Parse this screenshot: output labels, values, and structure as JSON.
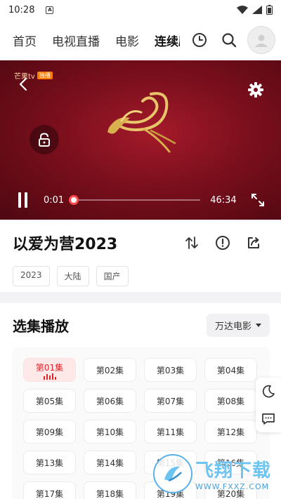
{
  "status_bar": {
    "time": "10:28",
    "sim_label": "A"
  },
  "nav": {
    "tabs": [
      {
        "label": "首页"
      },
      {
        "label": "电视直播"
      },
      {
        "label": "电影"
      },
      {
        "label": "连续剧"
      }
    ],
    "active_tab": "连续剧"
  },
  "player": {
    "logo_text": "芒果tv",
    "logo_tag": "独播",
    "current_time": "0:01",
    "total_time": "46:34",
    "progress": 0.0
  },
  "show": {
    "title": "以爱为营2023",
    "tags": [
      "2023",
      "大陆",
      "国产"
    ]
  },
  "episodes": {
    "section_title": "选集播放",
    "source": "万达电影",
    "items": [
      "第01集",
      "第02集",
      "第03集",
      "第04集",
      "第05集",
      "第06集",
      "第07集",
      "第08集",
      "第09集",
      "第10集",
      "第11集",
      "第12集",
      "第13集",
      "第14集",
      "第15集",
      "第16集",
      "第17集",
      "第18集",
      "第19集",
      "第20集"
    ],
    "active_index": 0
  },
  "watermark": {
    "cn": "飞翔下载",
    "url": "WWW.FXXZ.COM"
  },
  "colors": {
    "accent": "#e0242b",
    "player_bg": "#7a0f1c",
    "progress": "#ff5f00"
  },
  "icons": [
    "history-icon",
    "search-icon",
    "avatar-icon",
    "back-icon",
    "settings-icon",
    "lock-icon",
    "pause-icon",
    "fullscreen-icon",
    "sort-icon",
    "report-icon",
    "share-icon",
    "night-mode-icon",
    "feedback-icon"
  ]
}
